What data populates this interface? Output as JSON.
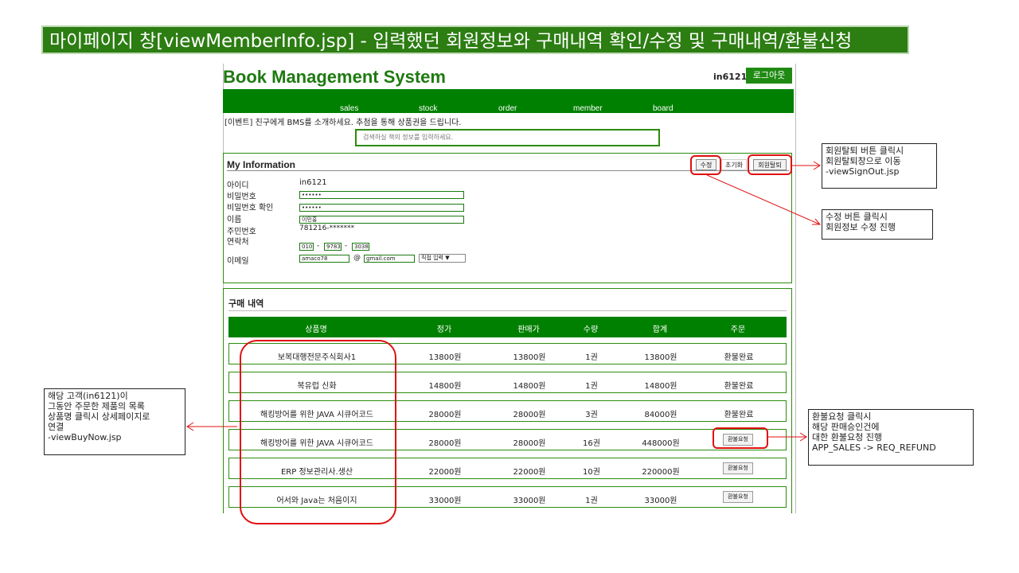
{
  "banner": {
    "text": "마이페이지 창[viewMemberInfo.jsp] - 입력했던 회원정보와 구매내역 확인/수정 및 구매내역/환불신청"
  },
  "header": {
    "title": "Book Management System",
    "user": "in6121",
    "logout": "로그아웃"
  },
  "nav": {
    "items": [
      "sales",
      "stock",
      "order",
      "member",
      "board"
    ]
  },
  "event_text": "[이벤트] 친구에게 BMS를 소개하세요. 추첨을 통해 상품권을 드립니다.",
  "search": {
    "placeholder": "검색하실 책의 정보를 입력하세요."
  },
  "info": {
    "title": "My Information",
    "buttons": {
      "edit": "수정",
      "reset": "초기화",
      "withdraw": "회원탈퇴"
    },
    "labels": {
      "id": "아이디",
      "pw": "비밀번호",
      "pw_confirm": "비밀번호 확인",
      "name": "이름",
      "ssn": "주민번호",
      "phone": "연락처",
      "email": "이메일"
    },
    "values": {
      "id": "in6121",
      "pw": "••••••",
      "pw_confirm": "••••••",
      "name": "이민홍",
      "ssn": "781216-*******",
      "phone1": "010",
      "phone2": "9783",
      "phone3": "3038",
      "phone_sep": "-",
      "email_user": "amaco78",
      "email_at": "@",
      "email_domain": "gmail.com",
      "email_select": "직접 입력 ▼"
    }
  },
  "purchase": {
    "title": "구매 내역",
    "headers": [
      "상품명",
      "정가",
      "판매가",
      "수량",
      "합계",
      "주문"
    ],
    "rows": [
      {
        "name": "보복대행전문주식회사1",
        "price": "13800원",
        "sale": "13800원",
        "qty": "1권",
        "total": "13800원",
        "order": "환불완료"
      },
      {
        "name": "복유럽 신화",
        "price": "14800원",
        "sale": "14800원",
        "qty": "1권",
        "total": "14800원",
        "order": "환불완료"
      },
      {
        "name": "해킹방어를 위한 JAVA 시큐어코드",
        "price": "28000원",
        "sale": "28000원",
        "qty": "3권",
        "total": "84000원",
        "order": "환불완료"
      },
      {
        "name": "해킹방어를 위한 JAVA 시큐어코드",
        "price": "28000원",
        "sale": "28000원",
        "qty": "16권",
        "total": "448000원",
        "order": "환불요청"
      },
      {
        "name": "ERP 정보관리사.생산",
        "price": "22000원",
        "sale": "22000원",
        "qty": "10권",
        "total": "220000원",
        "order": "환불요청"
      },
      {
        "name": "어서와 Java는 처음이지",
        "price": "33000원",
        "sale": "33000원",
        "qty": "1권",
        "total": "33000원",
        "order": "환불요청"
      }
    ]
  },
  "notes": {
    "withdraw": "회원탈퇴 버튼 클릭시\n회원탈퇴창으로 이동\n-viewSignOut.jsp",
    "edit": "수정 버튼 클릭시\n회원정보 수정 진행",
    "product": "해당 고객(in6121)이\n그동안 주문한 제품의 목록\n상품명 클릭시 상세페이지로\n연결\n-viewBuyNow.jsp",
    "refund": "환불요청 클릭시\n해당 판매승인건에\n대한 환불요청 진행\nAPP_SALES -> REQ_REFUND"
  },
  "colors": {
    "green": "#008000",
    "annotation": "#e01010"
  }
}
